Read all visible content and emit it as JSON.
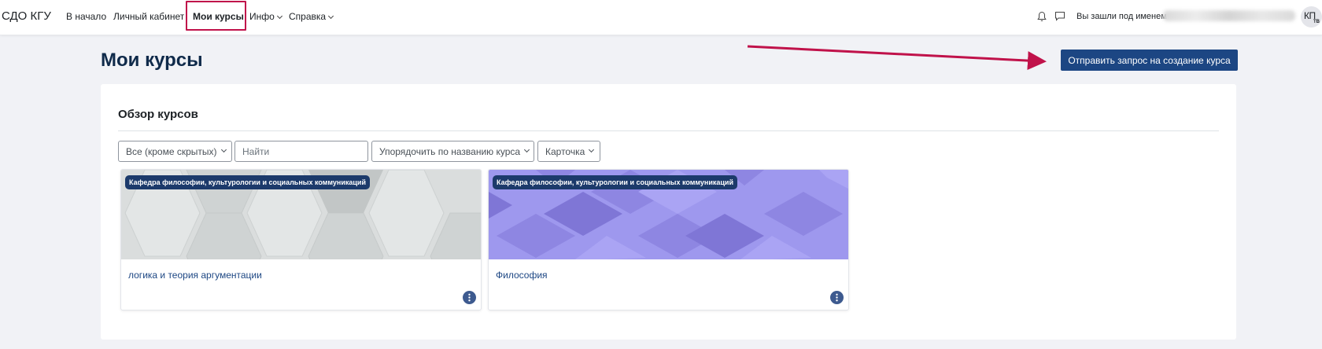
{
  "navbar": {
    "brand": "СДО КГУ",
    "items": [
      {
        "label": "В начало"
      },
      {
        "label": "Личный кабинет"
      },
      {
        "label": "Мои курсы"
      },
      {
        "label": "Инфо"
      },
      {
        "label": "Справка"
      }
    ],
    "icons": [
      "bell-icon",
      "chat-icon"
    ],
    "logged_in_text": "Вы зашли под именем",
    "avatar_initials": "КП",
    "avatar_sub": "ТВ"
  },
  "page": {
    "title": "Мои курсы",
    "create_button": "Отправить запрос на создание курса"
  },
  "overview": {
    "title": "Обзор курсов",
    "filter": "Все (кроме скрытых)",
    "search_placeholder": "Найти",
    "sort": "Упорядочить по названию курса",
    "view": "Карточка"
  },
  "courses": [
    {
      "department": "Кафедра философии, культурологии и социальных коммуникаций",
      "name": "логика и теория аргументации"
    },
    {
      "department": "Кафедра философии, культурологии и социальных коммуникаций",
      "name": "Философия"
    }
  ],
  "colors": {
    "accent": "#1c4683",
    "highlight": "#c0124a",
    "title": "#0f2a4a"
  }
}
